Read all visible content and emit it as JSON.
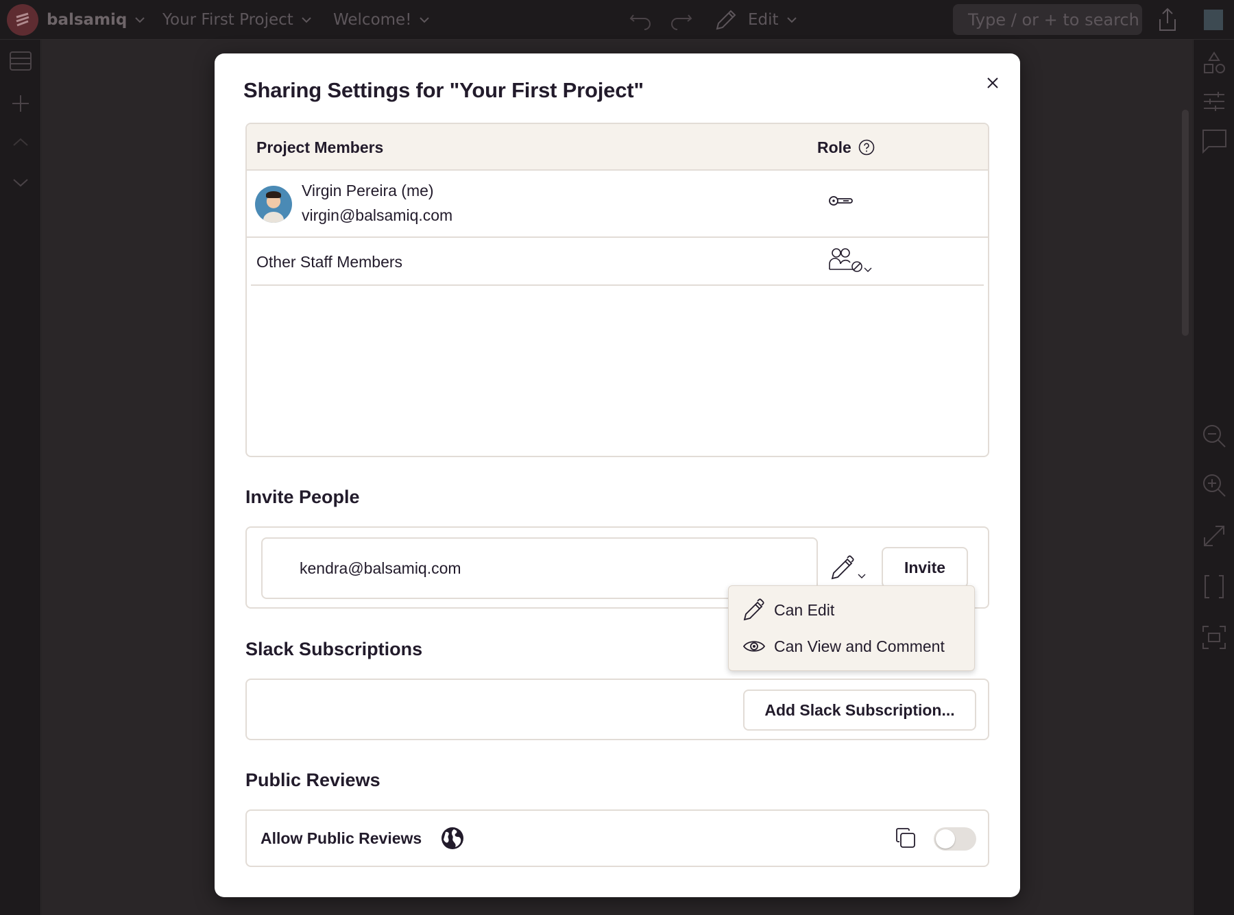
{
  "topbar": {
    "brand": "balsamiq",
    "project": "Your First Project",
    "page": "Welcome!",
    "mode": "Edit",
    "search_placeholder": "Type / or + to search"
  },
  "modal": {
    "title": "Sharing Settings for \"Your First Project\"",
    "members": {
      "header_members": "Project Members",
      "header_role": "Role",
      "me_name": "Virgin Pereira (me)",
      "me_email": "virgin@balsamiq.com",
      "staff_label": "Other Staff Members"
    },
    "invite": {
      "title": "Invite People",
      "email_value": "kendra@balsamiq.com",
      "button": "Invite"
    },
    "role_menu": {
      "items": [
        {
          "label": "Can Edit",
          "icon": "pencil-icon"
        },
        {
          "label": "Can View and Comment",
          "icon": "eye-icon"
        }
      ]
    },
    "slack": {
      "title": "Slack Subscriptions",
      "button": "Add Slack Subscription..."
    },
    "public": {
      "title": "Public Reviews",
      "label": "Allow Public Reviews",
      "enabled": false
    }
  }
}
